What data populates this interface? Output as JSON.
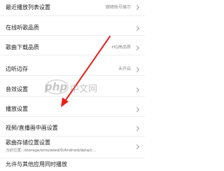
{
  "settings": {
    "items": [
      {
        "label": "最近播放列表设置",
        "value": "跟随账号展示"
      },
      {
        "label": "在线听歌品质",
        "value": ""
      },
      {
        "label": "歌曲下载品质",
        "value": "HQ高品质"
      },
      {
        "label": "边听边存",
        "value": "未开启"
      },
      {
        "label": "音效设置",
        "value": ""
      },
      {
        "label": "播放设置",
        "value": ""
      },
      {
        "label": "视频/直播画中画设置",
        "value": ""
      },
      {
        "label": "歌曲存储位置设置",
        "value": "",
        "sub_prefix": "当前位置:",
        "sub_path": "/storage/emulated/0/Android/data/c..."
      },
      {
        "label": "允许与其他应用同时播放",
        "value": ""
      }
    ]
  },
  "watermark": {
    "php": "php",
    "cn": "中文网"
  },
  "annotation": {
    "arrow_color": "#e8221b"
  }
}
